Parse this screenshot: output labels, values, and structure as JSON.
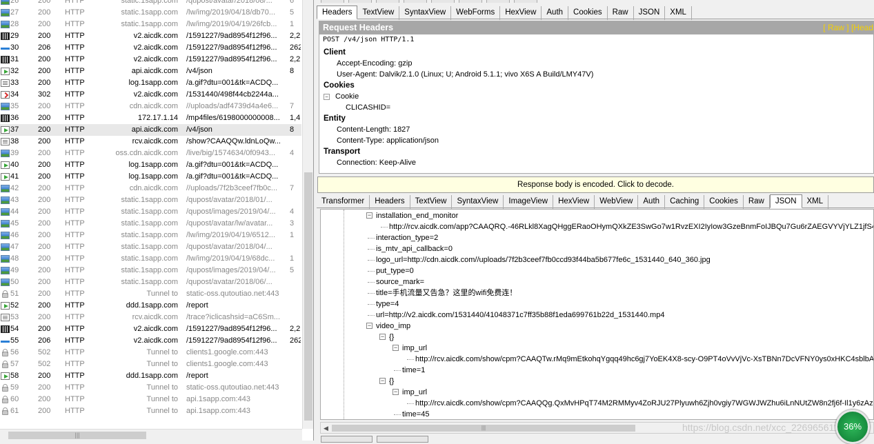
{
  "sessions": [
    {
      "num": "26",
      "result": "200",
      "protocol": "HTTP",
      "host": "static.1sapp.com",
      "url": "/qupost/avatar/2018/08/...",
      "body": "6",
      "icon": "image-icon",
      "dim": true
    },
    {
      "num": "27",
      "result": "200",
      "protocol": "HTTP",
      "host": "static.1sapp.com",
      "url": "/lw/img/2019/04/18/db70...",
      "body": "5",
      "icon": "image-icon",
      "dim": true
    },
    {
      "num": "28",
      "result": "200",
      "protocol": "HTTP",
      "host": "static.1sapp.com",
      "url": "/lw/img/2019/04/19/26fcb...",
      "body": "1",
      "icon": "image-icon",
      "dim": true
    },
    {
      "num": "29",
      "result": "200",
      "protocol": "HTTP",
      "host": "v2.aicdk.com",
      "url": "/1591227/9ad8954f12f96...",
      "body": "2,2",
      "icon": "video-icon",
      "dim": false
    },
    {
      "num": "30",
      "result": "206",
      "protocol": "HTTP",
      "host": "v2.aicdk.com",
      "url": "/1591227/9ad8954f12f96...",
      "body": "262",
      "icon": "partial-icon",
      "dim": false
    },
    {
      "num": "31",
      "result": "200",
      "protocol": "HTTP",
      "host": "v2.aicdk.com",
      "url": "/1591227/9ad8954f12f96...",
      "body": "2,2",
      "icon": "video-icon",
      "dim": false
    },
    {
      "num": "32",
      "result": "200",
      "protocol": "HTTP",
      "host": "api.aicdk.com",
      "url": "/v4/json",
      "body": "8",
      "icon": "json-arrow-icon",
      "dim": false
    },
    {
      "num": "33",
      "result": "200",
      "protocol": "HTTP",
      "host": "log.1sapp.com",
      "url": "/a.gif?dtu=001&tk=ACDQ...",
      "body": "",
      "icon": "document-icon",
      "dim": false
    },
    {
      "num": "34",
      "result": "302",
      "protocol": "HTTP",
      "host": "v2.aicdk.com",
      "url": "/1531440/498f44cb2244a...",
      "body": "",
      "icon": "redirect-icon",
      "dim": false
    },
    {
      "num": "35",
      "result": "200",
      "protocol": "HTTP",
      "host": "cdn.aicdk.com",
      "url": "//uploads/adf4739d4a4e6...",
      "body": "7",
      "icon": "image-icon",
      "dim": true
    },
    {
      "num": "36",
      "result": "200",
      "protocol": "HTTP",
      "host": "172.17.1.14",
      "url": "/mp4files/6198000000008...",
      "body": "1,4",
      "icon": "video-icon",
      "dim": false
    },
    {
      "num": "37",
      "result": "200",
      "protocol": "HTTP",
      "host": "api.aicdk.com",
      "url": "/v4/json",
      "body": "8",
      "icon": "json-arrow-icon",
      "dim": false,
      "selected": true
    },
    {
      "num": "38",
      "result": "200",
      "protocol": "HTTP",
      "host": "rcv.aicdk.com",
      "url": "/show?CAAQQw.ldnLoQw...",
      "body": "",
      "icon": "document-icon",
      "dim": false
    },
    {
      "num": "39",
      "result": "200",
      "protocol": "HTTP",
      "host": "oss.cdn.aicdk.com",
      "url": "/live/big/1574634/0f0943...",
      "body": "4",
      "icon": "image-icon",
      "dim": true
    },
    {
      "num": "40",
      "result": "200",
      "protocol": "HTTP",
      "host": "log.1sapp.com",
      "url": "/a.gif?dtu=001&tk=ACDQ...",
      "body": "",
      "icon": "json-arrow-icon",
      "dim": false
    },
    {
      "num": "41",
      "result": "200",
      "protocol": "HTTP",
      "host": "log.1sapp.com",
      "url": "/a.gif?dtu=001&tk=ACDQ...",
      "body": "",
      "icon": "json-arrow-icon",
      "dim": false
    },
    {
      "num": "42",
      "result": "200",
      "protocol": "HTTP",
      "host": "cdn.aicdk.com",
      "url": "//uploads/7f2b3ceef7fb0c...",
      "body": "7",
      "icon": "image-icon",
      "dim": true
    },
    {
      "num": "43",
      "result": "200",
      "protocol": "HTTP",
      "host": "static.1sapp.com",
      "url": "/qupost/avatar/2018/01/...",
      "body": "",
      "icon": "image-icon",
      "dim": true
    },
    {
      "num": "44",
      "result": "200",
      "protocol": "HTTP",
      "host": "static.1sapp.com",
      "url": "/qupost/images/2019/04/...",
      "body": "4",
      "icon": "image-icon",
      "dim": true
    },
    {
      "num": "45",
      "result": "200",
      "protocol": "HTTP",
      "host": "static.1sapp.com",
      "url": "/qupost/avatar/lw/avatar...",
      "body": "3",
      "icon": "image-icon",
      "dim": true
    },
    {
      "num": "46",
      "result": "200",
      "protocol": "HTTP",
      "host": "static.1sapp.com",
      "url": "/lw/img/2019/04/19/6512...",
      "body": "1",
      "icon": "image-icon",
      "dim": true
    },
    {
      "num": "47",
      "result": "200",
      "protocol": "HTTP",
      "host": "static.1sapp.com",
      "url": "/qupost/avatar/2018/04/...",
      "body": "",
      "icon": "image-icon",
      "dim": true
    },
    {
      "num": "48",
      "result": "200",
      "protocol": "HTTP",
      "host": "static.1sapp.com",
      "url": "/lw/img/2019/04/19/68dc...",
      "body": "1",
      "icon": "image-icon",
      "dim": true
    },
    {
      "num": "49",
      "result": "200",
      "protocol": "HTTP",
      "host": "static.1sapp.com",
      "url": "/qupost/images/2019/04/...",
      "body": "5",
      "icon": "image-icon",
      "dim": true
    },
    {
      "num": "50",
      "result": "200",
      "protocol": "HTTP",
      "host": "static.1sapp.com",
      "url": "/qupost/avatar/2018/06/...",
      "body": "",
      "icon": "image-icon",
      "dim": true
    },
    {
      "num": "51",
      "result": "200",
      "protocol": "HTTP",
      "host": "Tunnel to",
      "url": "static-oss.qutoutiao.net:443",
      "body": "",
      "icon": "lock-icon",
      "dim": true
    },
    {
      "num": "52",
      "result": "200",
      "protocol": "HTTP",
      "host": "ddd.1sapp.com",
      "url": "/report",
      "body": "",
      "icon": "json-arrow-icon",
      "dim": false
    },
    {
      "num": "53",
      "result": "200",
      "protocol": "HTTP",
      "host": "rcv.aicdk.com",
      "url": "/trace?iclicashsid=aC6Sm...",
      "body": "",
      "icon": "document-icon",
      "dim": true
    },
    {
      "num": "54",
      "result": "200",
      "protocol": "HTTP",
      "host": "v2.aicdk.com",
      "url": "/1591227/9ad8954f12f96...",
      "body": "2,2",
      "icon": "video-icon",
      "dim": false
    },
    {
      "num": "55",
      "result": "206",
      "protocol": "HTTP",
      "host": "v2.aicdk.com",
      "url": "/1591227/9ad8954f12f96...",
      "body": "262",
      "icon": "partial-icon",
      "dim": false
    },
    {
      "num": "56",
      "result": "502",
      "protocol": "HTTP",
      "host": "Tunnel to",
      "url": "clients1.google.com:443",
      "body": "",
      "icon": "lock-icon",
      "dim": true
    },
    {
      "num": "57",
      "result": "502",
      "protocol": "HTTP",
      "host": "Tunnel to",
      "url": "clients1.google.com:443",
      "body": "",
      "icon": "lock-icon",
      "dim": true
    },
    {
      "num": "58",
      "result": "200",
      "protocol": "HTTP",
      "host": "ddd.1sapp.com",
      "url": "/report",
      "body": "",
      "icon": "json-arrow-icon",
      "dim": false
    },
    {
      "num": "59",
      "result": "200",
      "protocol": "HTTP",
      "host": "Tunnel to",
      "url": "static-oss.qutoutiao.net:443",
      "body": "",
      "icon": "lock-icon",
      "dim": true
    },
    {
      "num": "60",
      "result": "200",
      "protocol": "HTTP",
      "host": "Tunnel to",
      "url": "api.1sapp.com:443",
      "body": "",
      "icon": "lock-icon",
      "dim": true
    },
    {
      "num": "61",
      "result": "200",
      "protocol": "HTTP",
      "host": "Tunnel to",
      "url": "api.1sapp.com:443",
      "body": "",
      "icon": "lock-icon",
      "dim": true
    }
  ],
  "request_tabs": [
    "Headers",
    "TextView",
    "SyntaxView",
    "WebForms",
    "HexView",
    "Auth",
    "Cookies",
    "Raw",
    "JSON",
    "XML"
  ],
  "request": {
    "title": "Request Headers",
    "links": "[ Raw ]   [Head",
    "request_line": "POST /v4/json HTTP/1.1",
    "sections": [
      {
        "name": "Client",
        "items": [
          "Accept-Encoding: gzip",
          "User-Agent: Dalvik/2.1.0 (Linux; U; Android 5.1.1; vivo X6S A Build/LMY47V)"
        ]
      },
      {
        "name": "Cookies",
        "cookie_node": "Cookie",
        "cookie_value": "CLICASHID="
      },
      {
        "name": "Entity",
        "items": [
          "Content-Length: 1827",
          "Content-Type: application/json"
        ]
      },
      {
        "name": "Transport",
        "items": [
          "Connection: Keep-Alive"
        ]
      }
    ]
  },
  "notice": "Response body is encoded. Click to decode.",
  "response_tabs": [
    "Transformer",
    "Headers",
    "TextView",
    "SyntaxView",
    "ImageView",
    "HexView",
    "WebView",
    "Auth",
    "Caching",
    "Cookies",
    "Raw",
    "JSON",
    "XML"
  ],
  "json_tree": [
    {
      "text": "installation_end_monitor",
      "depth": 0,
      "toggle": "−"
    },
    {
      "text": "http://rcv.aicdk.com/app?CAAQRQ.-46RLkl8XagQHggERaoOHymQXkZE3SwGo7w1RvzEXI2IyIow3GzeBnmFoIJBQu7Gu6rZAEGVYVjYLZ1jfS4V5S",
      "depth": 1
    },
    {
      "text": "interaction_type=2",
      "depth": 0
    },
    {
      "text": "is_mtv_api_callback=0",
      "depth": 0
    },
    {
      "text": "logo_url=http://cdn.aicdk.com//uploads/7f2b3ceef7fb0ccd93f44ba5b677fe6c_1531440_640_360.jpg",
      "depth": 0
    },
    {
      "text": "put_type=0",
      "depth": 0
    },
    {
      "text": "source_mark=",
      "depth": 0
    },
    {
      "text": "title=手机流量又告急？这里的wifi免费连！",
      "depth": 0
    },
    {
      "text": "type=4",
      "depth": 0
    },
    {
      "text": "url=http://v2.aicdk.com/1531440/41048371c7ff35b88f1eda699761b22d_1531440.mp4",
      "depth": 0
    },
    {
      "text": "video_imp",
      "depth": 0,
      "toggle": "−"
    },
    {
      "text": "{}",
      "depth": 1,
      "toggle": "−"
    },
    {
      "text": "imp_url",
      "depth": 2,
      "toggle": "−"
    },
    {
      "text": "http://rcv.aicdk.com/show/cpm?CAAQTw.rMq9mEtkohqYgqq49hc6gj7YoEK4X8-scy-O9PT4oVvVjVc-XsTBNn7DcVFNY0ys0xHKC4sblbAlmk",
      "depth": 3
    },
    {
      "text": "time=1",
      "depth": 2
    },
    {
      "text": "{}",
      "depth": 1,
      "toggle": "−"
    },
    {
      "text": "imp_url",
      "depth": 2,
      "toggle": "−"
    },
    {
      "text": "http://rcv.aicdk.com/show/cpm?CAAQQg.QxMvHPqT74M2RMMyv4ZoRJU27Plyuwh6Zjh0vgiy7WGWJWZhu6iLnNUtZW8n2fj6f-Il1y6zAzE",
      "depth": 3
    },
    {
      "text": "time=45",
      "depth": 2
    }
  ],
  "badge": "36%",
  "watermark": "https://blog.csdn.net/xcc_22696561128"
}
